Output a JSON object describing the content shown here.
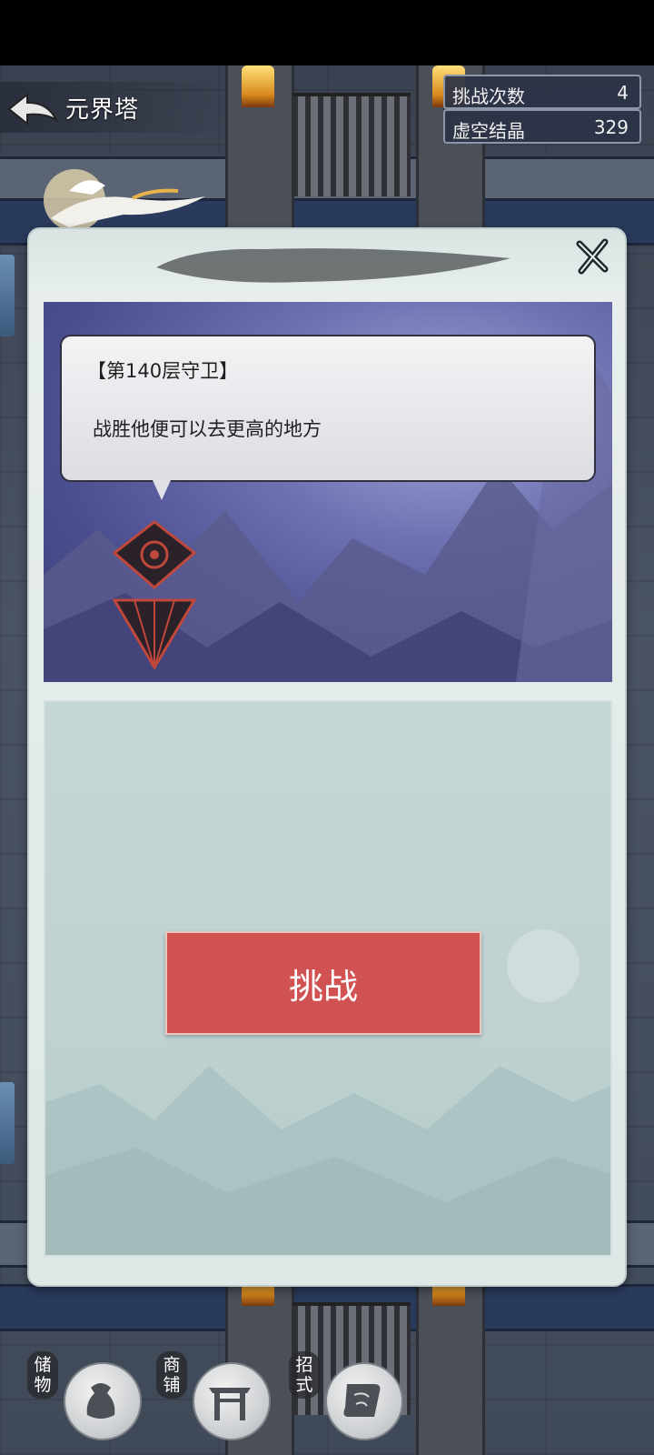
{
  "header": {
    "title": "元界塔"
  },
  "stats": [
    {
      "label": "挑战次数",
      "value": "4"
    },
    {
      "label": "虚空结晶",
      "value": "329"
    }
  ],
  "dialog": {
    "speech_title": "【第140层守卫】",
    "speech_text": "战胜他便可以去更高的地方",
    "challenge_label": "挑战"
  },
  "bottom_nav": [
    {
      "label": "储物",
      "icon": "bag-icon"
    },
    {
      "label": "商铺",
      "icon": "shop-gate-icon"
    },
    {
      "label": "招式",
      "icon": "scroll-icon"
    }
  ],
  "colors": {
    "challenge_button": "#d05252",
    "dialog_bg": "#dfe8e7",
    "panel_bg": "#bfd1d1"
  }
}
